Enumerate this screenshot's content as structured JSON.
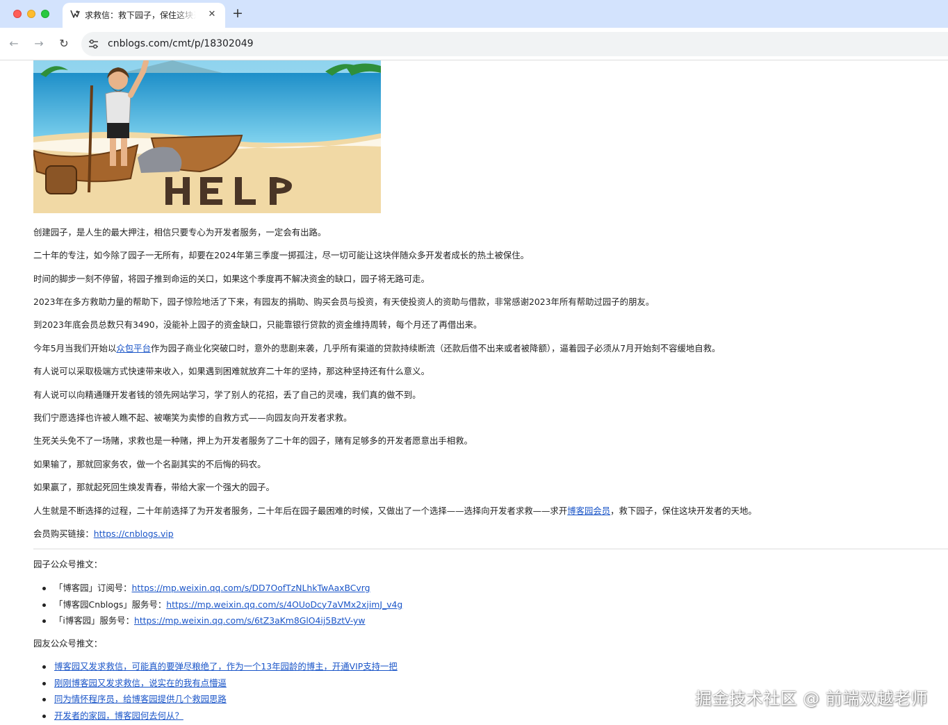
{
  "browser": {
    "tab_title": "求救信：救下园子，保住这块开发者的天地",
    "tab_close_glyph": "✕",
    "new_tab_glyph": "+",
    "back_glyph": "←",
    "forward_glyph": "→",
    "reload_glyph": "↻",
    "url": "cnblogs.com/cmt/p/18302049"
  },
  "hero_image": {
    "description_icon": "castaway-help-illustration",
    "help_text": "HELP"
  },
  "article": {
    "p1": "创建园子，是人生的最大押注，相信只要专心为开发者服务，一定会有出路。",
    "p2": "二十年的专注，如今除了园子一无所有，却要在2024年第三季度一掷孤注，尽一切可能让这块伴随众多开发者成长的热土被保住。",
    "p3": "时间的脚步一刻不停留，将园子推到命运的关口，如果这个季度再不解决资金的缺口，园子将无路可走。",
    "p4": "2023年在多方救助力量的帮助下，园子惊险地活了下来，有园友的捐助、购买会员与投资，有天使投资人的资助与借款，非常感谢2023年所有帮助过园子的朋友。",
    "p5": "到2023年底会员总数只有3490，没能补上园子的资金缺口，只能靠银行贷款的资金维持周转，每个月还了再借出来。",
    "p6_before": "今年5月当我们开始以",
    "p6_link": "众包平台",
    "p6_after": "作为园子商业化突破口时，意外的悲剧来袭，几乎所有渠道的贷款持续断流（还款后借不出来或者被降额），逼着园子必须从7月开始刻不容缓地自救。",
    "p7": "有人说可以采取极端方式快速带来收入，如果遇到困难就放弃二十年的坚持，那这种坚持还有什么意义。",
    "p8": "有人说可以向精通赚开发者钱的领先网站学习，学了别人的花招，丢了自己的灵魂，我们真的做不到。",
    "p9": "我们宁愿选择也许被人瞧不起、被嘲笑为卖惨的自救方式——向园友向开发者求救。",
    "p10": "生死关头免不了一场赌，求救也是一种赌，押上为开发者服务了二十年的园子，赌有足够多的开发者愿意出手相救。",
    "p11": "如果输了，那就回家务农，做一个名副其实的不后悔的码农。",
    "p12": "如果赢了，那就起死回生焕发青春，带给大家一个强大的园子。",
    "p13_before": "人生就是不断选择的过程，二十年前选择了为开发者服务，二十年后在园子最困难的时候，又做出了一个选择——选择向开发者求救——求开",
    "p13_link": "博客园会员",
    "p13_after": "，救下园子，保住这块开发者的天地。",
    "p14_label": "会员购买链接：",
    "p14_link": "https://cnblogs.vip",
    "official_heading": "园子公众号推文：",
    "official_items": [
      {
        "label": "「博客园」订阅号：",
        "link": "https://mp.weixin.qq.com/s/DD7OofTzNLhkTwAaxBCvrg"
      },
      {
        "label": "「博客园Cnblogs」服务号：",
        "link": "https://mp.weixin.qq.com/s/4OUoDcy7aVMx2xjimJ_v4g"
      },
      {
        "label": "「i博客园」服务号：",
        "link": "https://mp.weixin.qq.com/s/6tZ3aKm8GlO4ij5BztV-yw"
      }
    ],
    "friends_heading": "园友公众号推文：",
    "friends_items": [
      "博客园又发求救信，可能真的要弹尽粮绝了，作为一个13年园龄的博主，开通VIP支持一把",
      "刚刚博客园又发求救信，说实在的我有点懵逼",
      "同为情怀程序员，给博客园提供几个救园思路",
      "开发者的家园，博客园何去何从？"
    ]
  },
  "watermark": "掘金技术社区 @ 前端双越老师",
  "colors": {
    "tab_strip": "#d3e3fd",
    "link": "#1a55c8",
    "omnibox": "#f1f3f4"
  }
}
